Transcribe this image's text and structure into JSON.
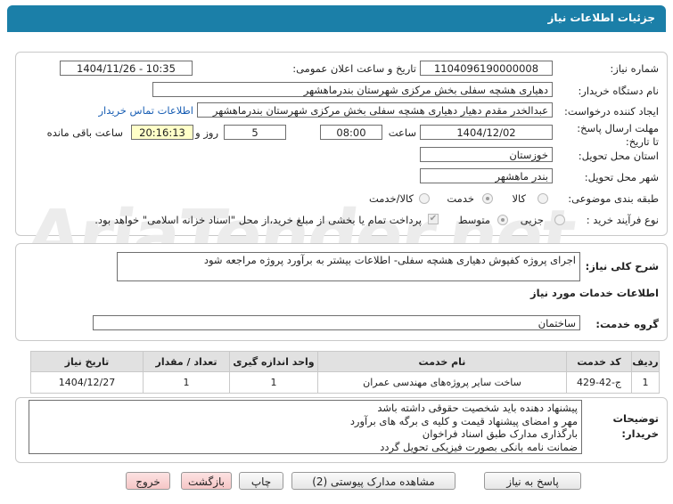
{
  "header": {
    "title": "جزئیات اطلاعات نیاز"
  },
  "watermark": "AriaTender.net",
  "colors": {
    "header": "#1b7fa8",
    "link": "#1a5fb4",
    "exit_button_bg": "#f7caca"
  },
  "form": {
    "need_number_label": "شماره نیاز:",
    "need_number": "1104096190000008",
    "announce_label": "تاریخ و ساعت اعلان عمومی:",
    "announce_value": "1404/11/26 - 10:35",
    "buyer_label": "نام دستگاه خریدار:",
    "buyer_value": "دهیاری هشچه سفلی بخش مرکزی شهرستان بندرماهشهر",
    "creator_label": "ایجاد کننده درخواست:",
    "creator_value": "عبدالخدر مقدم دهیار دهیاری هشچه سفلی بخش مرکزی شهرستان بندرماهشهر",
    "contact_link": "اطلاعات تماس خریدار",
    "deadline_label": "مهلت ارسال پاسخ: تا تاریخ:",
    "deadline_date": "1404/12/02",
    "time_label": "ساعت",
    "deadline_time": "08:00",
    "days_value": "5",
    "days_label": "روز و",
    "remaining_time": "20:16:13",
    "remaining_label": "ساعت باقی مانده",
    "province_label": "استان محل تحویل:",
    "province_value": "خوزستان",
    "city_label": "شهر محل تحویل:",
    "city_value": "بندر ماهشهر",
    "category_label": "طبقه بندی موضوعی:",
    "category_options": [
      "کالا",
      "خدمت",
      "کالا/خدمت"
    ],
    "category_selected": "خدمت",
    "process_label": "نوع فرآیند خرید :",
    "process_options": [
      "جزیی",
      "متوسط"
    ],
    "process_selected": "متوسط",
    "process_note": "پرداخت تمام یا بخشی از مبلغ خرید،از محل \"اسناد خزانه اسلامی\" خواهد بود."
  },
  "description": {
    "label": "شرح کلی نیاز:",
    "value": "اجرای پروژه کفپوش دهیاری هشچه سفلی- اطلاعات بیشتر به برآورد پروژه مراجعه شود"
  },
  "services": {
    "title": "اطلاعات خدمات مورد نیاز",
    "group_label": "گروه خدمت:",
    "group_value": "ساختمان",
    "table": {
      "headers": [
        "ردیف",
        "کد خدمت",
        "نام خدمت",
        "واحد اندازه گیری",
        "تعداد / مقدار",
        "تاریخ نیاز"
      ],
      "rows": [
        [
          "1",
          "ج-42-429",
          "ساخت سایر پروژه‌های مهندسی عمران",
          "1",
          "1",
          "1404/12/27"
        ]
      ]
    }
  },
  "buyer_notes": {
    "label": "توضیحات خریدار:",
    "lines": [
      "پیشنهاد دهنده باید شخصیت حقوقی داشته باشد",
      "مهر و امضای پیشنهاد قیمت و کلیه ی برگه های برآورد",
      "بارگذاری مدارک طبق اسناد فراخوان",
      "ضمانت نامه بانکی بصورت فیزیکی تحویل گردد"
    ]
  },
  "buttons": {
    "reply": "پاسخ به نیاز",
    "attachments": "مشاهده مدارک پیوستی (2)",
    "print": "چاپ",
    "back": "بازگشت",
    "exit": "خروج"
  }
}
